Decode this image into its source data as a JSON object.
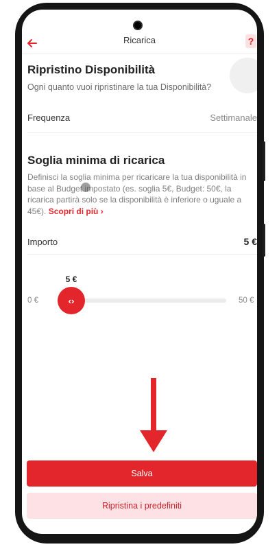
{
  "header": {
    "title": "Ricarica",
    "help_label": "?"
  },
  "restore": {
    "title": "Ripristino Disponibilità",
    "subtitle": "Ogni quanto vuoi ripristinare la tua Disponibilità?",
    "frequency_label": "Frequenza",
    "frequency_value": "Settimanale"
  },
  "threshold": {
    "title": "Soglia minima di ricarica",
    "description": "Definisci la soglia minima per ricaricare la tua disponibilità in base al Budget impostato (es. soglia 5€, Budget: 50€, la ricarica partirà solo se la disponibilità è inferiore o uguale a 45€).",
    "link_label": "Scopri di più ›",
    "amount_label": "Importo",
    "amount_value": "5 €"
  },
  "slider": {
    "min_label": "0 €",
    "max_label": "50 €",
    "current_label": "5 €",
    "handle_glyph": "‹›",
    "value": 5,
    "min": 0,
    "max": 50
  },
  "actions": {
    "save_label": "Salva",
    "reset_label": "Ripristina i predefiniti"
  },
  "colors": {
    "accent": "#e3262b",
    "accent_light": "#fde1e4"
  }
}
